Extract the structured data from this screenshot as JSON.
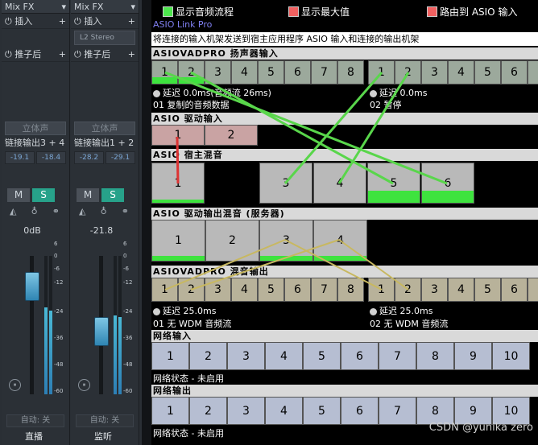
{
  "mixer": {
    "strips": [
      {
        "fx_label": "Mix FX",
        "insert_label": "插入",
        "insert_slot": "",
        "post_fader_label": "推子后",
        "stereo_label": "立体声",
        "link_output": "链接输出3 + 4",
        "peak_left": "-19.1",
        "peak_right": "-18.4",
        "mute_label": "M",
        "solo_label": "S",
        "volume": "0dB",
        "automation": "自动: 关",
        "name": "直播"
      },
      {
        "fx_label": "Mix FX",
        "insert_label": "插入",
        "insert_slot": "L2 Stereo",
        "post_fader_label": "推子后",
        "stereo_label": "立体声",
        "link_output": "链接输出1 + 2",
        "peak_left": "-28.2",
        "peak_right": "-29.1",
        "mute_label": "M",
        "solo_label": "S",
        "volume": "-21.8",
        "automation": "自动: 关",
        "name": "监听"
      }
    ],
    "scale": [
      "6",
      "0",
      "-6",
      "-12",
      "-24",
      "-36",
      "-48",
      "-60"
    ],
    "fader_level_db": [
      0,
      -21.8
    ]
  },
  "asio": {
    "options": {
      "show_audio_flow": "显示音频流程",
      "show_max_value": "显示最大值",
      "route_to_asio_input": "路由到 ASIO 输入"
    },
    "brand": "ASIO Link Pro",
    "description": "将连接的输入机架发送到宿主应用程序 ASIO 输入和连接的输出机架",
    "sections": {
      "speaker_input": "ASIOVADPRO 扬声器输入",
      "driver_input": "ASIO 驱动输入",
      "host_mix": "ASIO 宿主混音",
      "driver_output_mix": "ASIO 驱动输出混音 (服务器)",
      "mix_output": "ASIOVADPRO 混音输出",
      "network_input": "网络输入",
      "network_output": "网络输出"
    },
    "speaker_input": {
      "group1": [
        "1",
        "2",
        "3",
        "4",
        "5",
        "6",
        "7",
        "8"
      ],
      "group2": [
        "1",
        "2",
        "3",
        "4",
        "5",
        "6",
        "7",
        "8"
      ],
      "info1_latency": "延迟 0.0ms(音频流 26ms)",
      "info1_label": "01 复制的音频数据",
      "info2_latency": "延迟 0.0ms",
      "info2_label": "02 暂停"
    },
    "driver_input": [
      "1",
      "2"
    ],
    "host_mix": [
      "1",
      "3",
      "4",
      "5",
      "6"
    ],
    "driver_output_mix": [
      "1",
      "2",
      "3",
      "4"
    ],
    "mix_output": {
      "group1": [
        "1",
        "2",
        "3",
        "4",
        "5",
        "6",
        "7",
        "8"
      ],
      "group2": [
        "1",
        "2",
        "3",
        "4",
        "5",
        "6",
        "7",
        "8"
      ],
      "info1_latency": "延迟 25.0ms",
      "info1_label": "01 无 WDM 音频流",
      "info2_latency": "延迟 25.0ms",
      "info2_label": "02 无 WDM 音频流"
    },
    "network_input": {
      "channels": [
        "1",
        "2",
        "3",
        "4",
        "5",
        "6",
        "7",
        "8",
        "9",
        "10"
      ],
      "status": "网络状态 - 未启用"
    },
    "network_output": {
      "channels": [
        "1",
        "2",
        "3",
        "4",
        "5",
        "6",
        "7",
        "8",
        "9",
        "10"
      ],
      "status": "网络状态 - 未启用"
    },
    "colors": {
      "flow_green": "#3ee33e",
      "gray_cell": "#9ca99c",
      "out_cell": "#b8b29a",
      "net_cell": "#b6bed2",
      "mix_cell": "#b9b9b9",
      "driver_in_cell": "#c9a3a3"
    }
  },
  "watermark": "CSDN @yunika zero"
}
